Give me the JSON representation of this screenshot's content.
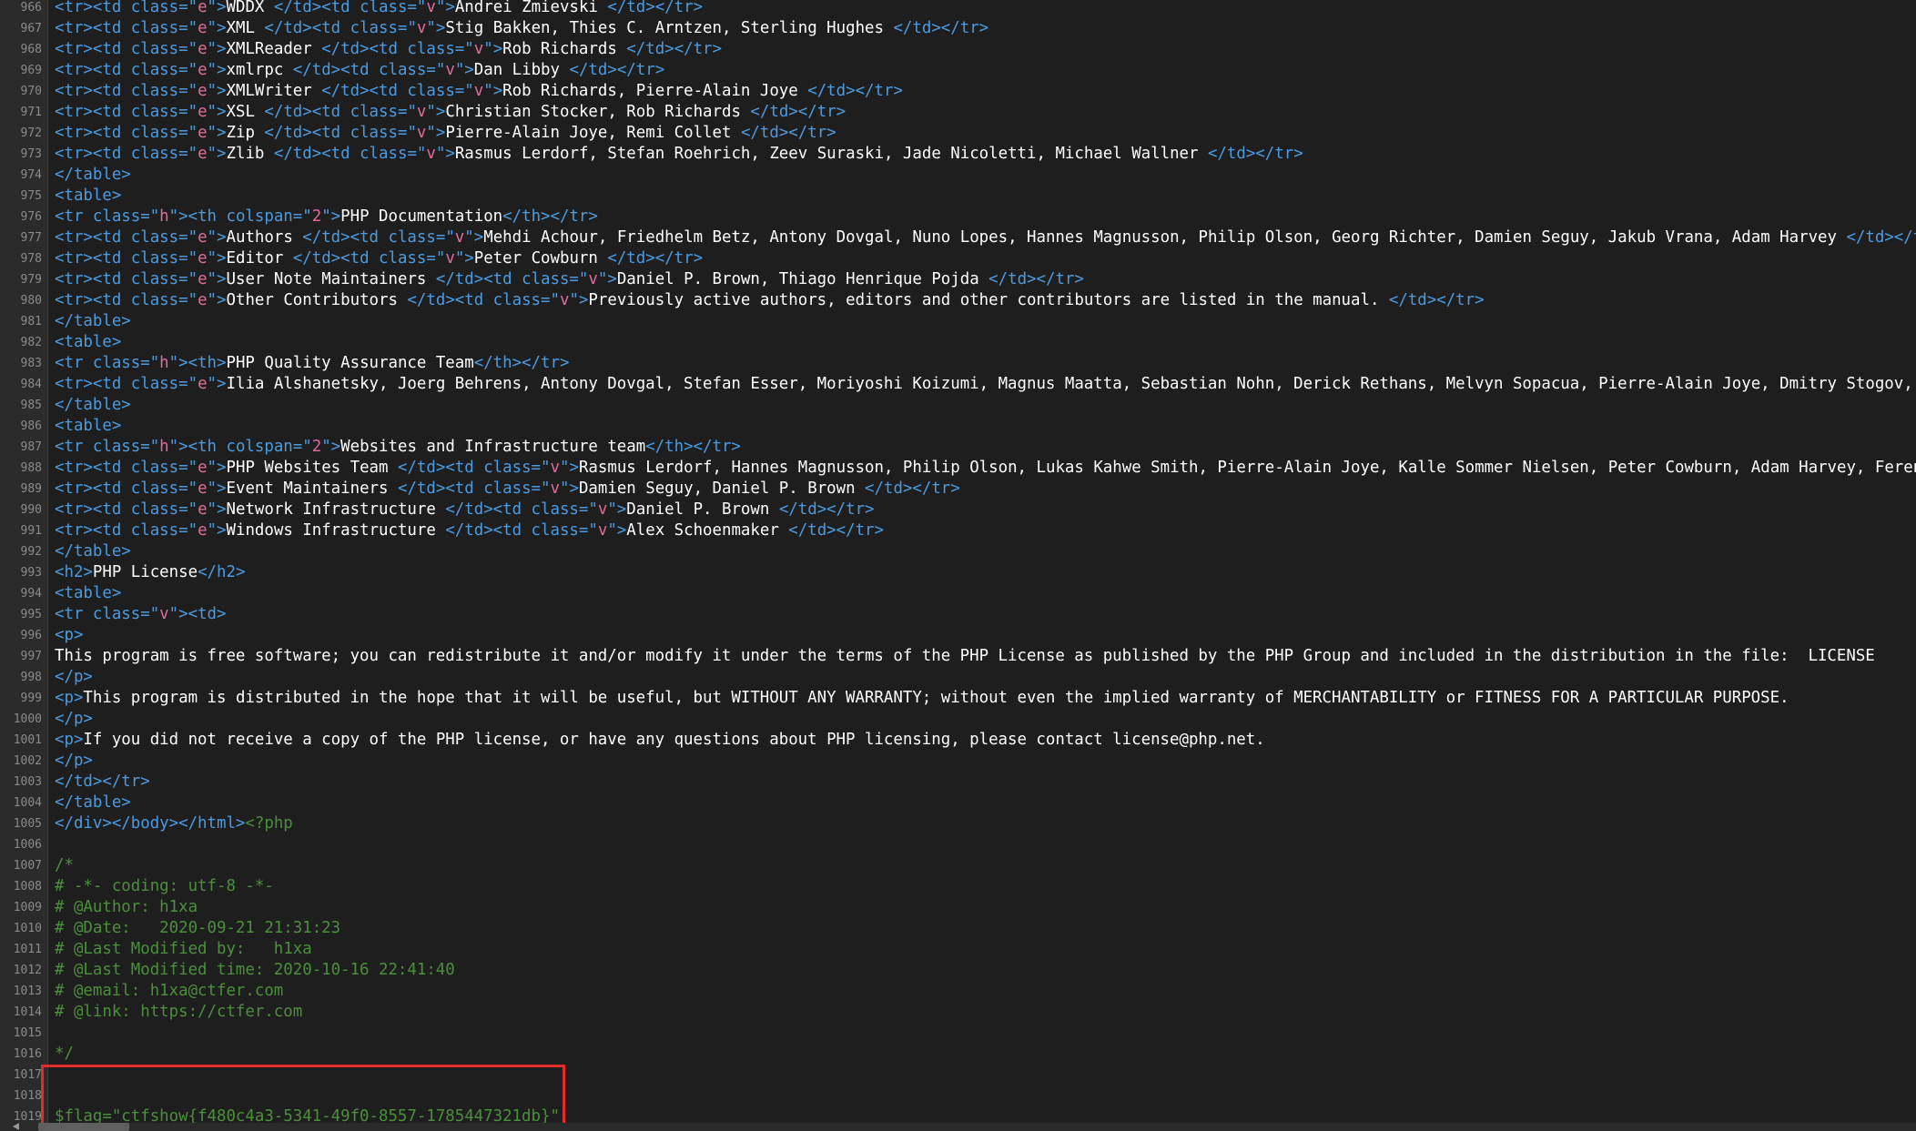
{
  "lines": [
    {
      "n": "966",
      "seg": [
        [
          "t",
          "<tr><td class=\""
        ],
        [
          "s",
          "e"
        ],
        [
          "t",
          "\">"
        ],
        [
          "p",
          "WDDX "
        ],
        [
          "t",
          "</td><td class=\""
        ],
        [
          "s",
          "v"
        ],
        [
          "t",
          "\">"
        ],
        [
          "p",
          "Andrei Zmievski "
        ],
        [
          "t",
          "</td></tr>"
        ]
      ]
    },
    {
      "n": "967",
      "seg": [
        [
          "t",
          "<tr><td class=\""
        ],
        [
          "s",
          "e"
        ],
        [
          "t",
          "\">"
        ],
        [
          "p",
          "XML "
        ],
        [
          "t",
          "</td><td class=\""
        ],
        [
          "s",
          "v"
        ],
        [
          "t",
          "\">"
        ],
        [
          "p",
          "Stig Bakken, Thies C. Arntzen, Sterling Hughes "
        ],
        [
          "t",
          "</td></tr>"
        ]
      ]
    },
    {
      "n": "968",
      "seg": [
        [
          "t",
          "<tr><td class=\""
        ],
        [
          "s",
          "e"
        ],
        [
          "t",
          "\">"
        ],
        [
          "p",
          "XMLReader "
        ],
        [
          "t",
          "</td><td class=\""
        ],
        [
          "s",
          "v"
        ],
        [
          "t",
          "\">"
        ],
        [
          "p",
          "Rob Richards "
        ],
        [
          "t",
          "</td></tr>"
        ]
      ]
    },
    {
      "n": "969",
      "seg": [
        [
          "t",
          "<tr><td class=\""
        ],
        [
          "s",
          "e"
        ],
        [
          "t",
          "\">"
        ],
        [
          "p",
          "xmlrpc "
        ],
        [
          "t",
          "</td><td class=\""
        ],
        [
          "s",
          "v"
        ],
        [
          "t",
          "\">"
        ],
        [
          "p",
          "Dan Libby "
        ],
        [
          "t",
          "</td></tr>"
        ]
      ]
    },
    {
      "n": "970",
      "seg": [
        [
          "t",
          "<tr><td class=\""
        ],
        [
          "s",
          "e"
        ],
        [
          "t",
          "\">"
        ],
        [
          "p",
          "XMLWriter "
        ],
        [
          "t",
          "</td><td class=\""
        ],
        [
          "s",
          "v"
        ],
        [
          "t",
          "\">"
        ],
        [
          "p",
          "Rob Richards, Pierre-Alain Joye "
        ],
        [
          "t",
          "</td></tr>"
        ]
      ]
    },
    {
      "n": "971",
      "seg": [
        [
          "t",
          "<tr><td class=\""
        ],
        [
          "s",
          "e"
        ],
        [
          "t",
          "\">"
        ],
        [
          "p",
          "XSL "
        ],
        [
          "t",
          "</td><td class=\""
        ],
        [
          "s",
          "v"
        ],
        [
          "t",
          "\">"
        ],
        [
          "p",
          "Christian Stocker, Rob Richards "
        ],
        [
          "t",
          "</td></tr>"
        ]
      ]
    },
    {
      "n": "972",
      "seg": [
        [
          "t",
          "<tr><td class=\""
        ],
        [
          "s",
          "e"
        ],
        [
          "t",
          "\">"
        ],
        [
          "p",
          "Zip "
        ],
        [
          "t",
          "</td><td class=\""
        ],
        [
          "s",
          "v"
        ],
        [
          "t",
          "\">"
        ],
        [
          "p",
          "Pierre-Alain Joye, Remi Collet "
        ],
        [
          "t",
          "</td></tr>"
        ]
      ]
    },
    {
      "n": "973",
      "seg": [
        [
          "t",
          "<tr><td class=\""
        ],
        [
          "s",
          "e"
        ],
        [
          "t",
          "\">"
        ],
        [
          "p",
          "Zlib "
        ],
        [
          "t",
          "</td><td class=\""
        ],
        [
          "s",
          "v"
        ],
        [
          "t",
          "\">"
        ],
        [
          "p",
          "Rasmus Lerdorf, Stefan Roehrich, Zeev Suraski, Jade Nicoletti, Michael Wallner "
        ],
        [
          "t",
          "</td></tr>"
        ]
      ]
    },
    {
      "n": "974",
      "seg": [
        [
          "t",
          "</table>"
        ]
      ]
    },
    {
      "n": "975",
      "seg": [
        [
          "t",
          "<table>"
        ]
      ]
    },
    {
      "n": "976",
      "seg": [
        [
          "t",
          "<tr class=\""
        ],
        [
          "s",
          "h"
        ],
        [
          "t",
          "\"><th colspan=\""
        ],
        [
          "s",
          "2"
        ],
        [
          "t",
          "\">"
        ],
        [
          "p",
          "PHP Documentation"
        ],
        [
          "t",
          "</th></tr>"
        ]
      ]
    },
    {
      "n": "977",
      "seg": [
        [
          "t",
          "<tr><td class=\""
        ],
        [
          "s",
          "e"
        ],
        [
          "t",
          "\">"
        ],
        [
          "p",
          "Authors "
        ],
        [
          "t",
          "</td><td class=\""
        ],
        [
          "s",
          "v"
        ],
        [
          "t",
          "\">"
        ],
        [
          "p",
          "Mehdi Achour, Friedhelm Betz, Antony Dovgal, Nuno Lopes, Hannes Magnusson, Philip Olson, Georg Richter, Damien Seguy, Jakub Vrana, Adam Harvey "
        ],
        [
          "t",
          "</td></tr>"
        ]
      ]
    },
    {
      "n": "978",
      "seg": [
        [
          "t",
          "<tr><td class=\""
        ],
        [
          "s",
          "e"
        ],
        [
          "t",
          "\">"
        ],
        [
          "p",
          "Editor "
        ],
        [
          "t",
          "</td><td class=\""
        ],
        [
          "s",
          "v"
        ],
        [
          "t",
          "\">"
        ],
        [
          "p",
          "Peter Cowburn "
        ],
        [
          "t",
          "</td></tr>"
        ]
      ]
    },
    {
      "n": "979",
      "seg": [
        [
          "t",
          "<tr><td class=\""
        ],
        [
          "s",
          "e"
        ],
        [
          "t",
          "\">"
        ],
        [
          "p",
          "User Note Maintainers "
        ],
        [
          "t",
          "</td><td class=\""
        ],
        [
          "s",
          "v"
        ],
        [
          "t",
          "\">"
        ],
        [
          "p",
          "Daniel P. Brown, Thiago Henrique Pojda "
        ],
        [
          "t",
          "</td></tr>"
        ]
      ]
    },
    {
      "n": "980",
      "seg": [
        [
          "t",
          "<tr><td class=\""
        ],
        [
          "s",
          "e"
        ],
        [
          "t",
          "\">"
        ],
        [
          "p",
          "Other Contributors "
        ],
        [
          "t",
          "</td><td class=\""
        ],
        [
          "s",
          "v"
        ],
        [
          "t",
          "\">"
        ],
        [
          "p",
          "Previously active authors, editors and other contributors are listed in the manual. "
        ],
        [
          "t",
          "</td></tr>"
        ]
      ]
    },
    {
      "n": "981",
      "seg": [
        [
          "t",
          "</table>"
        ]
      ]
    },
    {
      "n": "982",
      "seg": [
        [
          "t",
          "<table>"
        ]
      ]
    },
    {
      "n": "983",
      "seg": [
        [
          "t",
          "<tr class=\""
        ],
        [
          "s",
          "h"
        ],
        [
          "t",
          "\"><th>"
        ],
        [
          "p",
          "PHP Quality Assurance Team"
        ],
        [
          "t",
          "</th></tr>"
        ]
      ]
    },
    {
      "n": "984",
      "seg": [
        [
          "t",
          "<tr><td class=\""
        ],
        [
          "s",
          "e"
        ],
        [
          "t",
          "\">"
        ],
        [
          "p",
          "Ilia Alshanetsky, Joerg Behrens, Antony Dovgal, Stefan Esser, Moriyoshi Koizumi, Magnus Maatta, Sebastian Nohn, Derick Rethans, Melvyn Sopacua, Pierre-Alain Joye, Dmitry Stogov, Felipe Pena, D"
        ]
      ]
    },
    {
      "n": "985",
      "seg": [
        [
          "t",
          "</table>"
        ]
      ]
    },
    {
      "n": "986",
      "seg": [
        [
          "t",
          "<table>"
        ]
      ]
    },
    {
      "n": "987",
      "seg": [
        [
          "t",
          "<tr class=\""
        ],
        [
          "s",
          "h"
        ],
        [
          "t",
          "\"><th colspan=\""
        ],
        [
          "s",
          "2"
        ],
        [
          "t",
          "\">"
        ],
        [
          "p",
          "Websites and Infrastructure team"
        ],
        [
          "t",
          "</th></tr>"
        ]
      ]
    },
    {
      "n": "988",
      "seg": [
        [
          "t",
          "<tr><td class=\""
        ],
        [
          "s",
          "e"
        ],
        [
          "t",
          "\">"
        ],
        [
          "p",
          "PHP Websites Team "
        ],
        [
          "t",
          "</td><td class=\""
        ],
        [
          "s",
          "v"
        ],
        [
          "t",
          "\">"
        ],
        [
          "p",
          "Rasmus Lerdorf, Hannes Magnusson, Philip Olson, Lukas Kahwe Smith, Pierre-Alain Joye, Kalle Sommer Nielsen, Peter Cowburn, Adam Harvey, Ferenc Kovacs, Levi"
        ]
      ]
    },
    {
      "n": "989",
      "seg": [
        [
          "t",
          "<tr><td class=\""
        ],
        [
          "s",
          "e"
        ],
        [
          "t",
          "\">"
        ],
        [
          "p",
          "Event Maintainers "
        ],
        [
          "t",
          "</td><td class=\""
        ],
        [
          "s",
          "v"
        ],
        [
          "t",
          "\">"
        ],
        [
          "p",
          "Damien Seguy, Daniel P. Brown "
        ],
        [
          "t",
          "</td></tr>"
        ]
      ]
    },
    {
      "n": "990",
      "seg": [
        [
          "t",
          "<tr><td class=\""
        ],
        [
          "s",
          "e"
        ],
        [
          "t",
          "\">"
        ],
        [
          "p",
          "Network Infrastructure "
        ],
        [
          "t",
          "</td><td class=\""
        ],
        [
          "s",
          "v"
        ],
        [
          "t",
          "\">"
        ],
        [
          "p",
          "Daniel P. Brown "
        ],
        [
          "t",
          "</td></tr>"
        ]
      ]
    },
    {
      "n": "991",
      "seg": [
        [
          "t",
          "<tr><td class=\""
        ],
        [
          "s",
          "e"
        ],
        [
          "t",
          "\">"
        ],
        [
          "p",
          "Windows Infrastructure "
        ],
        [
          "t",
          "</td><td class=\""
        ],
        [
          "s",
          "v"
        ],
        [
          "t",
          "\">"
        ],
        [
          "p",
          "Alex Schoenmaker "
        ],
        [
          "t",
          "</td></tr>"
        ]
      ]
    },
    {
      "n": "992",
      "seg": [
        [
          "t",
          "</table>"
        ]
      ]
    },
    {
      "n": "993",
      "seg": [
        [
          "t",
          "<h2>"
        ],
        [
          "p",
          "PHP License"
        ],
        [
          "t",
          "</h2>"
        ]
      ]
    },
    {
      "n": "994",
      "seg": [
        [
          "t",
          "<table>"
        ]
      ]
    },
    {
      "n": "995",
      "seg": [
        [
          "t",
          "<tr class=\""
        ],
        [
          "s",
          "v"
        ],
        [
          "t",
          "\"><td>"
        ]
      ]
    },
    {
      "n": "996",
      "seg": [
        [
          "t",
          "<p>"
        ]
      ]
    },
    {
      "n": "997",
      "seg": [
        [
          "p",
          "This program is free software; you can redistribute it and/or modify it under the terms of the PHP License as published by the PHP Group and included in the distribution in the file:  LICENSE"
        ]
      ]
    },
    {
      "n": "998",
      "seg": [
        [
          "t",
          "</p>"
        ]
      ]
    },
    {
      "n": "999",
      "seg": [
        [
          "t",
          "<p>"
        ],
        [
          "p",
          "This program is distributed in the hope that it will be useful, but WITHOUT ANY WARRANTY; without even the implied warranty of MERCHANTABILITY or FITNESS FOR A PARTICULAR PURPOSE."
        ]
      ]
    },
    {
      "n": "1000",
      "seg": [
        [
          "t",
          "</p>"
        ]
      ]
    },
    {
      "n": "1001",
      "seg": [
        [
          "t",
          "<p>"
        ],
        [
          "p",
          "If you did not receive a copy of the PHP license, or have any questions about PHP licensing, please contact license@php.net."
        ]
      ]
    },
    {
      "n": "1002",
      "seg": [
        [
          "t",
          "</p>"
        ]
      ]
    },
    {
      "n": "1003",
      "seg": [
        [
          "t",
          "</td></tr>"
        ]
      ]
    },
    {
      "n": "1004",
      "seg": [
        [
          "t",
          "</table>"
        ]
      ]
    },
    {
      "n": "1005",
      "seg": [
        [
          "t",
          "</div></body></html>"
        ],
        [
          "c",
          "<?php"
        ]
      ]
    },
    {
      "n": "1006",
      "seg": []
    },
    {
      "n": "1007",
      "seg": [
        [
          "c",
          "/*"
        ]
      ]
    },
    {
      "n": "1008",
      "seg": [
        [
          "c",
          "# -*- coding: utf-8 -*-"
        ]
      ]
    },
    {
      "n": "1009",
      "seg": [
        [
          "c",
          "# @Author: h1xa"
        ]
      ]
    },
    {
      "n": "1010",
      "seg": [
        [
          "c",
          "# @Date:   2020-09-21 21:31:23"
        ]
      ]
    },
    {
      "n": "1011",
      "seg": [
        [
          "c",
          "# @Last Modified by:   h1xa"
        ]
      ]
    },
    {
      "n": "1012",
      "seg": [
        [
          "c",
          "# @Last Modified time: 2020-10-16 22:41:40"
        ]
      ]
    },
    {
      "n": "1013",
      "seg": [
        [
          "c",
          "# @email: h1xa@ctfer.com"
        ]
      ]
    },
    {
      "n": "1014",
      "seg": [
        [
          "c",
          "# @link: https://ctfer.com"
        ]
      ]
    },
    {
      "n": "1015",
      "seg": []
    },
    {
      "n": "1016",
      "seg": [
        [
          "c",
          "*/"
        ]
      ]
    },
    {
      "n": "1017",
      "seg": []
    },
    {
      "n": "1018",
      "seg": []
    },
    {
      "n": "1019",
      "seg": [
        [
          "c",
          "$flag=\"ctfshow{f480c4a3-5341-49f0-8557-1785447321db}\";"
        ]
      ]
    }
  ],
  "highlight_color": "#e32b2b",
  "colors": {
    "background": "#1e1e1e",
    "tag": "#4c9be0",
    "attr_value": "#e06c9c",
    "comment": "#4b8f3c",
    "text": "#ffffff",
    "line_number": "#8a8a8a"
  }
}
